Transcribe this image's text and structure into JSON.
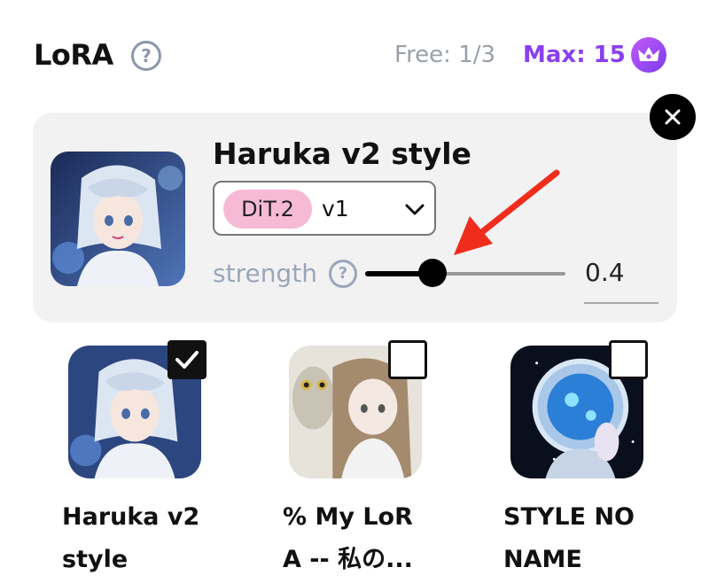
{
  "header": {
    "title": "LoRA",
    "help_glyph": "?",
    "free_label": "Free: 1/3",
    "max_label": "Max: 15",
    "crown_icon": "crown-icon",
    "accent_color": "#8a3ff0"
  },
  "selected": {
    "name": "Haruka v2 style",
    "badge": "DiT.2",
    "version": "v1",
    "strength_label": "strength",
    "strength_value": "0.4",
    "strength_fraction": 0.4,
    "badge_color": "#f7bad6"
  },
  "gallery": [
    {
      "name_line1": "Haruka v2",
      "name_line2": "style",
      "checked": true
    },
    {
      "name_line1": "% My LoR",
      "name_line2": "A -- 私の...",
      "checked": false
    },
    {
      "name_line1": "STYLE NO",
      "name_line2": "NAME",
      "checked": false
    }
  ]
}
